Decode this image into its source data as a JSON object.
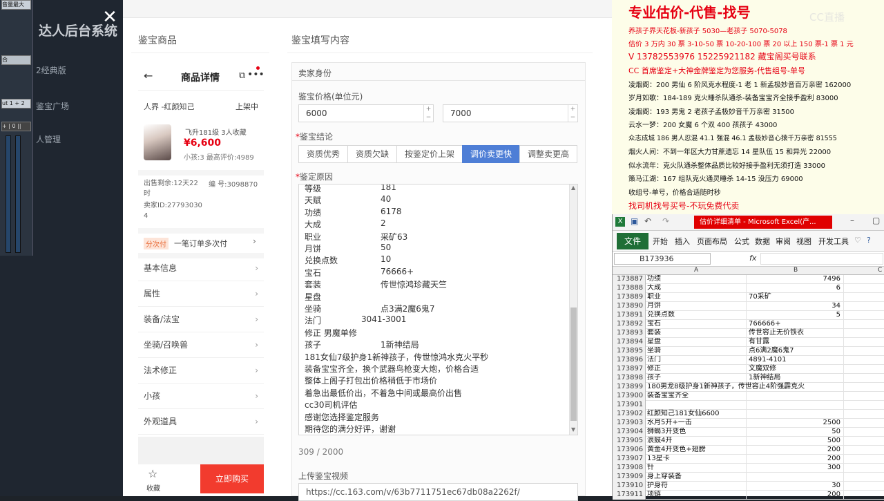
{
  "background": {
    "brand": "达人后台系统",
    "mixer_label_top": "音量最大",
    "mixer_label_mid": "ut 1 + 2",
    "nav": [
      "2经典版",
      "鉴宝广场",
      "人管理"
    ]
  },
  "modal": {
    "left_title": "鉴宝商品",
    "right_title": "鉴宝填写内容",
    "phone": {
      "header_title": "商品详情",
      "game": "人界 -红颜知己",
      "listing_status": "上架中",
      "char_info": "飞升181级 3人收藏",
      "price": "¥6,600",
      "extra": "小孩:3 最高评价:4989",
      "time_left": "出售剩余:12天22时",
      "number": "编 号:3098870",
      "seller_id": "卖家ID:277930304",
      "installment_badge": "分次付",
      "installment_text": "一笔订单多次付",
      "menu": [
        "基本信息",
        "属性",
        "装备/法宝",
        "坐骑/召唤兽",
        "法术修正",
        "小孩",
        "外观道具"
      ],
      "fav_label": "收藏",
      "buy_label": "立即购买"
    },
    "form": {
      "section": "卖家身份",
      "price_label": "鉴宝价格(单位元)",
      "price_min": "6000",
      "price_max": "7000",
      "conclusion_label": "鉴宝结论",
      "conclusion_options": [
        "资质优秀",
        "资质欠缺",
        "按鉴定价上架",
        "调价卖更快",
        "调整卖更高"
      ],
      "conclusion_active": 3,
      "reason_label": "鉴定原因",
      "reason_lines": [
        [
          "等级",
          "181"
        ],
        [
          "天赋",
          "40"
        ],
        [
          "功绩",
          "6178"
        ],
        [
          "大成",
          "2"
        ],
        [
          "职业",
          "采矿63"
        ],
        [
          "月饼",
          "50"
        ],
        [
          "兑换点数",
          "10"
        ],
        [
          "宝石",
          "76666+"
        ],
        [
          "套装",
          "传世惊鸿珍藏天竺"
        ],
        [
          "星盘",
          ""
        ],
        [
          "坐骑",
          "点3满2魔6鬼7"
        ],
        [
          "法门",
          "3041-3001"
        ],
        [
          "修正 男魔单修",
          ""
        ],
        [
          "孩子",
          "1新神结局"
        ],
        [
          "181女仙7级护身1新神孩子，传世惊鸿水克火平秒",
          ""
        ],
        [
          "装备宝宝齐全，换个武器鸟枪变大炮，价格合适",
          ""
        ],
        [
          "整体上阁子打包出价格稍低于市场价",
          ""
        ],
        [
          "着急出最低价出，不着急中间或最高价出售",
          ""
        ],
        [
          "cc30司机评估",
          ""
        ],
        [
          "感谢您选择鉴定服务",
          ""
        ],
        [
          "期待您的满分好评，谢谢",
          ""
        ]
      ],
      "char_count": "309 / 2000",
      "video_label": "上传鉴宝视频",
      "video_url": "https://cc.163.com/v/63b7711751ec67db08a2262f/"
    }
  },
  "ad": {
    "title": "专业估价-代售-找号",
    "lines_red": [
      "养孩子界天花板-新孩子 5030—老孩子 5070-5078",
      "估价 3 万内 30 票  3-10-50 票  10-20-100 票 20 以上 150 票-1 票 1 元",
      "V 13782553976    15225921182   藏宝阁买号联系",
      "CC 首席鉴定+大神金牌鉴定为您服务-代售组号-单号"
    ],
    "lines_black": [
      "凌烟阁：200 男仙 6 阶风克水程度-1 老 1 新孟极妙音百万亲密 162000",
      "岁月如歌：184-189 克火睡杀队通杀-装备宝宝齐全接手盈利 83000",
      "凌烟阁：193 男鬼 2 老孩子孟极妙音千万亲密 31500",
      "云水一梦：200 女魔 6 个双 400 孩孩子 43000",
      "众志成城 186 男人忍混 41.1 强混 46.1 孟极妙音心猿千万亲密 81555",
      "烟火人间：不到一年区大力甘蔗遗忘 14 星队伍 15 和异光 22000",
      "似水流年：克火队通杀整体品质比较好接手盈利无须打造 33000",
      "策马江湖：167 组队克火通灵睡杀 14-15 没压力 69000",
      "收组号-单号，价格合适随时秒"
    ],
    "footer": "找司机找号买号-不玩免费代卖",
    "watermark": "CC直播"
  },
  "excel": {
    "window_title": "估价详细清单 - Microsoft Excel(产...",
    "file_tab": "文件",
    "tabs": [
      "开始",
      "插入",
      "页面布局",
      "公式",
      "数据",
      "审阅",
      "视图",
      "开发工具"
    ],
    "name_box": "B173936",
    "fx": "fx",
    "col_a": "A",
    "col_b": "B",
    "col_c": "C",
    "rows": [
      [
        "173887",
        "功绩",
        "7496"
      ],
      [
        "173888",
        "大成",
        "6"
      ],
      [
        "173889",
        "职业",
        "70采矿"
      ],
      [
        "173890",
        "月饼",
        "34"
      ],
      [
        "173891",
        "兑换点数",
        "5"
      ],
      [
        "173892",
        "宝石",
        "766666+"
      ],
      [
        "173893",
        "套装",
        "传世容止无价铁衣"
      ],
      [
        "173894",
        "星盘",
        "有甘露"
      ],
      [
        "173895",
        "坐骑",
        "点6满2魔6鬼7"
      ],
      [
        "173896",
        "法门",
        "4891-4101"
      ],
      [
        "173897",
        "修正",
        "文魔双修"
      ],
      [
        "173898",
        "孩子",
        "1新神结局"
      ],
      [
        "173899",
        "180男龙8级护身1新神孩子，传世容止4阶强霹克火",
        ""
      ],
      [
        "173900",
        "装备宝宝齐全",
        ""
      ],
      [
        "173901",
        "",
        ""
      ],
      [
        "173902",
        "红颜知己181女仙6600",
        ""
      ],
      [
        "173903",
        "水月5开+一击",
        "2500"
      ],
      [
        "173904",
        "狮蝎3开变色",
        "50"
      ],
      [
        "173905",
        "浪鼓4开",
        "500"
      ],
      [
        "173906",
        "黄金4开变色+翅膀",
        "200"
      ],
      [
        "173907",
        "13星卡",
        "200"
      ],
      [
        "173908",
        "针",
        "300"
      ],
      [
        "173909",
        "身上穿装备",
        ""
      ],
      [
        "173910",
        "护身符",
        "30"
      ],
      [
        "173911",
        "项链",
        "200"
      ]
    ]
  }
}
